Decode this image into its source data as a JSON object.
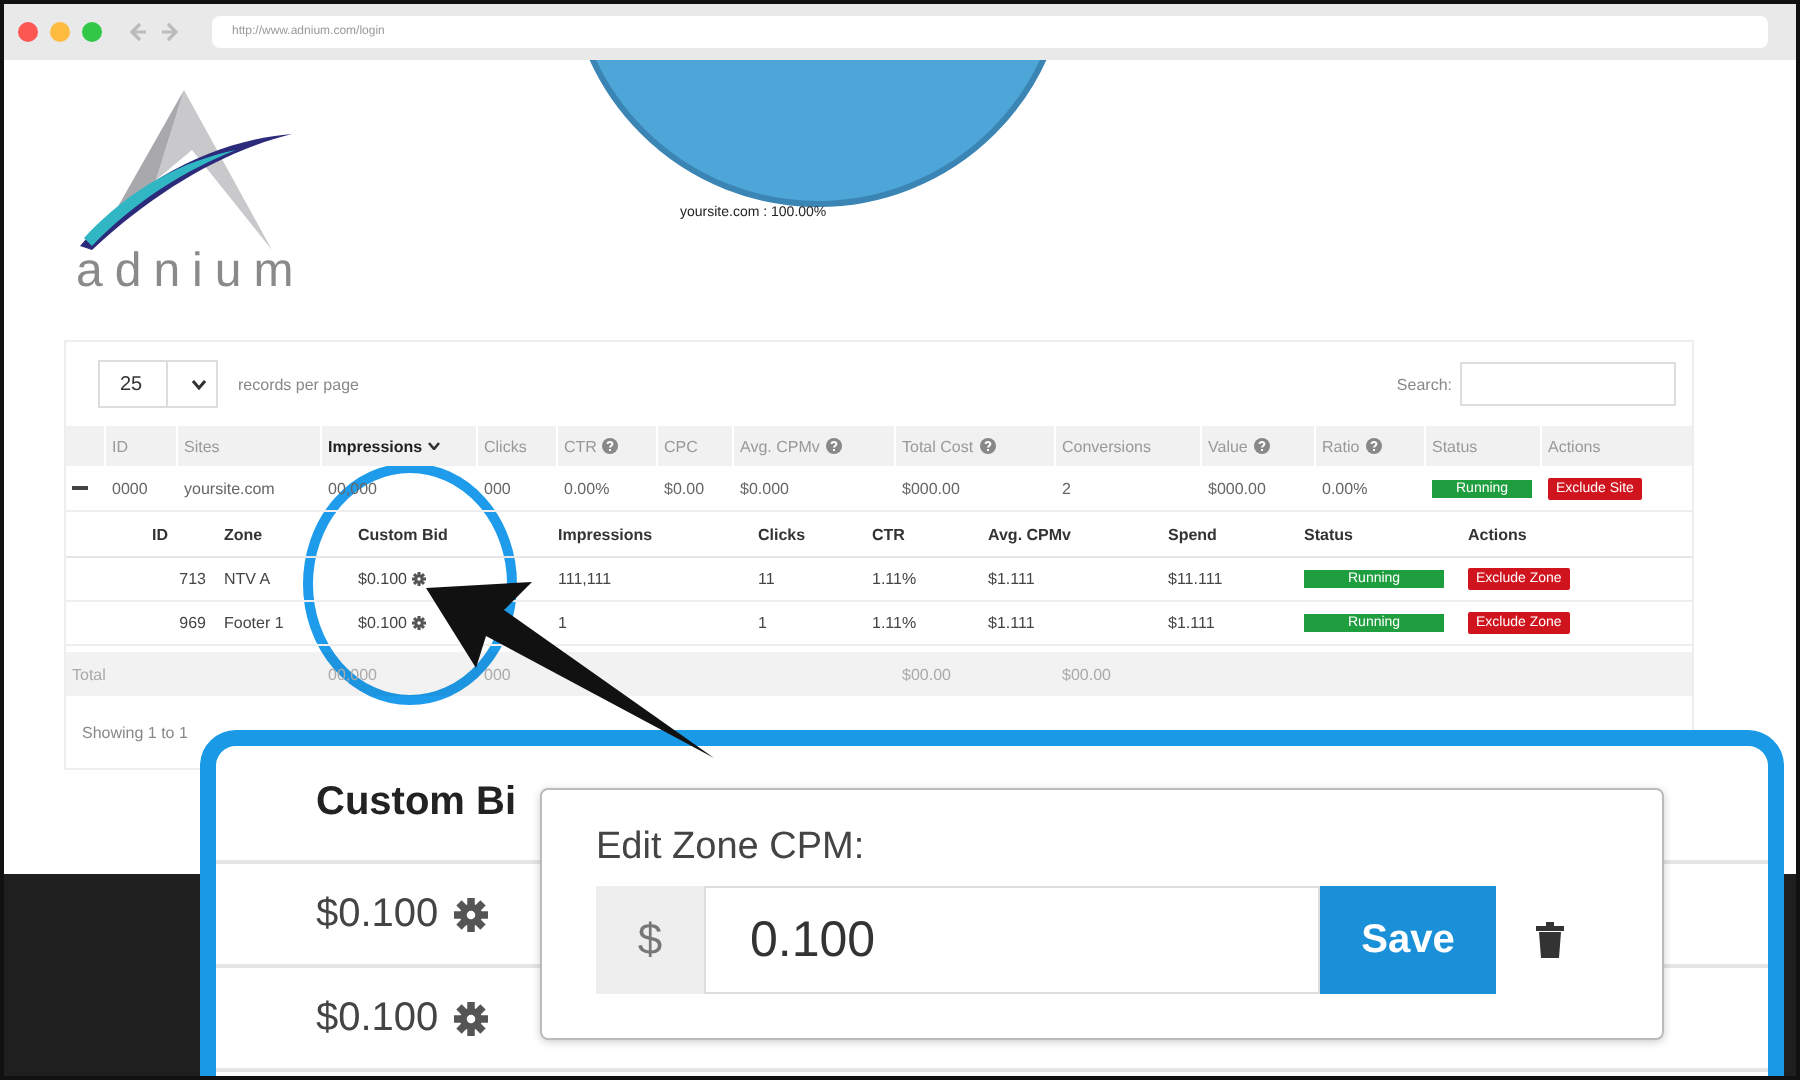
{
  "browser": {
    "url": "http://www.adnium.com/login"
  },
  "logo": {
    "text": "adnium"
  },
  "pie": {
    "label": "yoursite.com : 100.00%"
  },
  "table": {
    "page_size": "25",
    "page_size_label": "records per page",
    "search_label": "Search:",
    "columns": [
      {
        "label": "ID",
        "info": false,
        "sorted": false
      },
      {
        "label": "Sites",
        "info": false,
        "sorted": false
      },
      {
        "label": "Impressions",
        "info": false,
        "sorted": true
      },
      {
        "label": "Clicks",
        "info": false,
        "sorted": false
      },
      {
        "label": "CTR",
        "info": true,
        "sorted": false
      },
      {
        "label": "CPC",
        "info": false,
        "sorted": false
      },
      {
        "label": "Avg. CPMv",
        "info": true,
        "sorted": false
      },
      {
        "label": "Total Cost",
        "info": true,
        "sorted": false
      },
      {
        "label": "Conversions",
        "info": false,
        "sorted": false
      },
      {
        "label": "Value",
        "info": true,
        "sorted": false
      },
      {
        "label": "Ratio",
        "info": true,
        "sorted": false
      },
      {
        "label": "Status",
        "info": false,
        "sorted": false
      },
      {
        "label": "Actions",
        "info": false,
        "sorted": false
      }
    ],
    "rows": [
      {
        "expanded": true,
        "cells": [
          "0000",
          "yoursite.com",
          "00,000",
          "000",
          "0.00%",
          "$0.00",
          "$0.000",
          "$000.00",
          "2",
          "$000.00",
          "0.00%"
        ],
        "status": "Running",
        "action": "Exclude Site",
        "zones": {
          "columns": [
            "ID",
            "Zone",
            "Custom Bid",
            "Impressions",
            "Clicks",
            "CTR",
            "Avg. CPMv",
            "Spend",
            "Status",
            "Actions"
          ],
          "rows": [
            {
              "cells": [
                "713",
                "NTV A",
                "$0.100",
                "111,111",
                "11",
                "1.11%",
                "$1.111",
                "$11.111"
              ],
              "status": "Running",
              "action": "Exclude Zone"
            },
            {
              "cells": [
                "969",
                "Footer 1",
                "$0.100",
                "1",
                "1",
                "1.11%",
                "$1.111",
                "$1.111"
              ],
              "status": "Running",
              "action": "Exclude Zone"
            }
          ]
        }
      }
    ],
    "totals": {
      "label": "Total",
      "impressions": "00,000",
      "clicks": "000",
      "total_cost": "$00.00",
      "conversions": "$00.00"
    },
    "footer_text": "Showing 1 to 1"
  },
  "callout": {
    "heading": "Custom Bi",
    "bids": [
      "$0.100",
      "$0.100"
    ],
    "popover": {
      "title": "Edit Zone CPM:",
      "prefix": "$",
      "value": "0.100",
      "button": "Save"
    }
  }
}
